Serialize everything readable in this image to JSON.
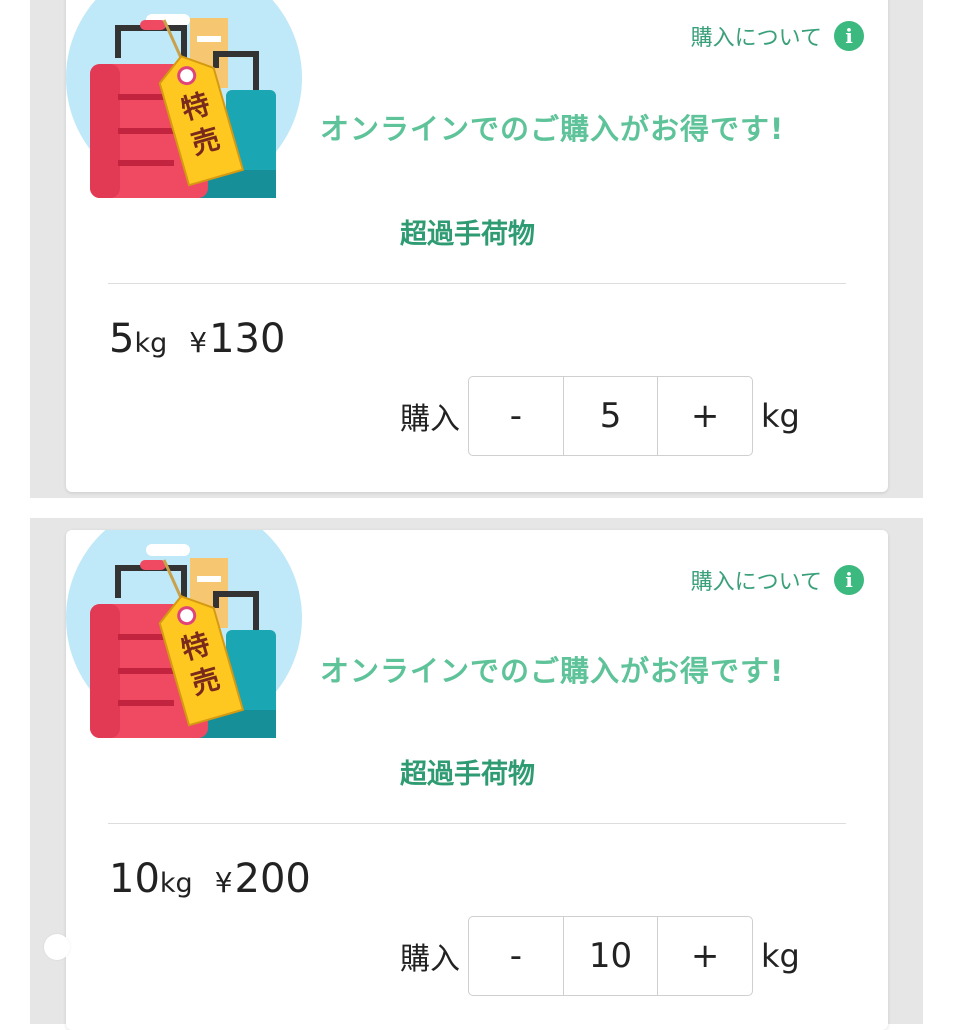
{
  "cards": [
    {
      "tag_text": "特売",
      "about_label": "購入について",
      "info_icon": "i",
      "promo_text": "オンラインでのご購入がお得です!",
      "category": "超過手荷物",
      "weight": "5",
      "weight_unit": "kg",
      "currency": "¥",
      "price": "130",
      "buy_label": "購入",
      "minus": "-",
      "quantity": "5",
      "plus": "+",
      "quantity_unit": "kg"
    },
    {
      "tag_text": "特売",
      "about_label": "購入について",
      "info_icon": "i",
      "promo_text": "オンラインでのご購入がお得です!",
      "category": "超過手荷物",
      "weight": "10",
      "weight_unit": "kg",
      "currency": "¥",
      "price": "200",
      "buy_label": "購入",
      "minus": "-",
      "quantity": "10",
      "plus": "+",
      "quantity_unit": "kg"
    }
  ],
  "colors": {
    "accent_green": "#3cb97f",
    "promo_green": "#5fc39a",
    "category_green": "#2f9b72",
    "panel_gray": "#e6e6e6",
    "suitcase_red": "#f04a63",
    "suitcase_teal": "#1aa7b3",
    "tag_yellow": "#ffc820"
  }
}
